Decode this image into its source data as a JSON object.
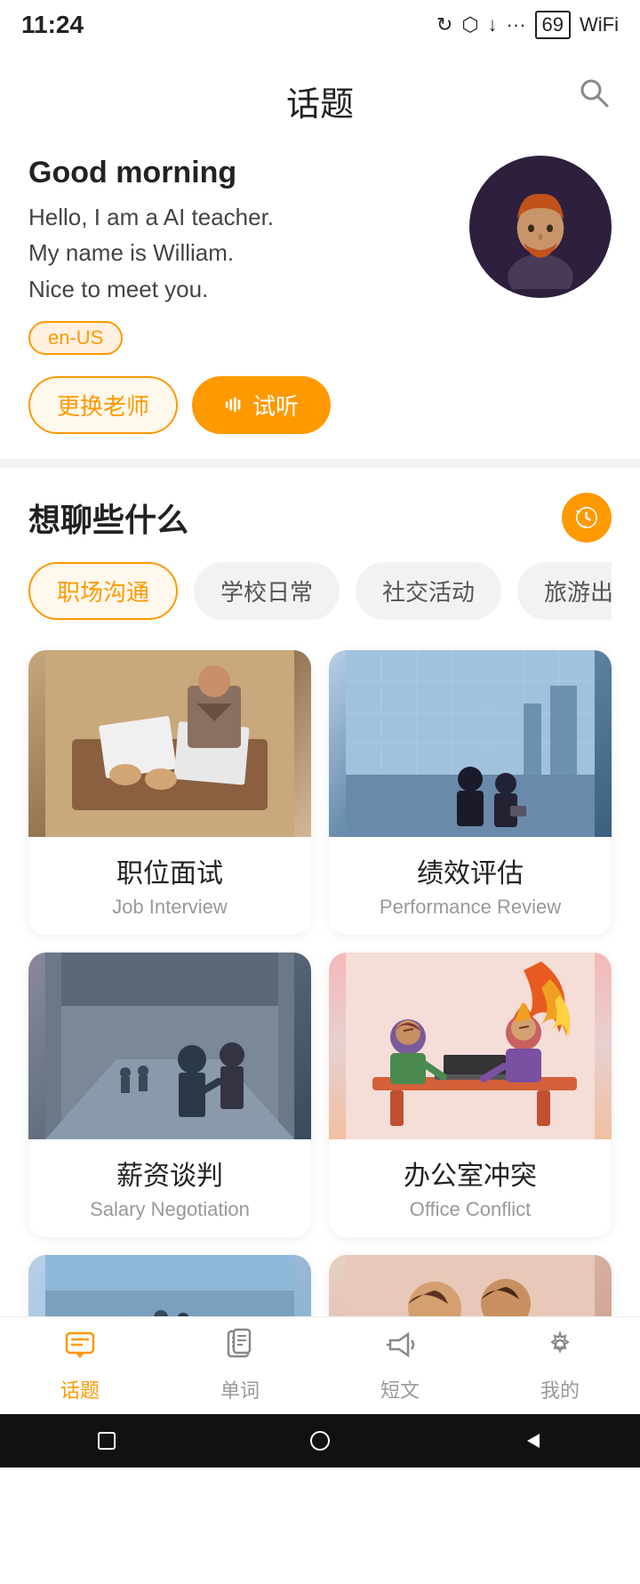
{
  "statusBar": {
    "time": "11:24",
    "icons": [
      "sync",
      "cloud",
      "download",
      "more"
    ]
  },
  "header": {
    "title": "话题",
    "searchLabel": "search"
  },
  "teacher": {
    "greeting": "Good morning",
    "intro": "Hello, I am a AI teacher.\nMy name is William.\nNice to meet you.",
    "lang": "en-US",
    "changeTeacherLabel": "更换老师",
    "auditionLabel": "试听"
  },
  "topicsSection": {
    "title": "想聊些什么",
    "historyLabel": "history"
  },
  "categories": [
    {
      "id": "workplace",
      "zh": "职场沟通",
      "active": true
    },
    {
      "id": "school",
      "zh": "学校日常",
      "active": false
    },
    {
      "id": "social",
      "zh": "社交活动",
      "active": false
    },
    {
      "id": "travel",
      "zh": "旅游出行",
      "active": false
    }
  ],
  "topics": [
    {
      "id": 1,
      "zh": "职位面试",
      "en": "Job Interview",
      "imgStyle": "topic-img-1"
    },
    {
      "id": 2,
      "zh": "绩效评估",
      "en": "Performance Review",
      "imgStyle": "topic-img-2"
    },
    {
      "id": 3,
      "zh": "薪资谈判",
      "en": "Salary Negotiation",
      "imgStyle": "topic-img-3"
    },
    {
      "id": 4,
      "zh": "办公室冲突",
      "en": "Office Conflict",
      "imgStyle": "topic-img-4"
    }
  ],
  "partialTopics": [
    {
      "id": 5,
      "imgStyle": "topic-img-partial-1"
    },
    {
      "id": 6,
      "imgStyle": "topic-img-partial-2"
    }
  ],
  "bottomNav": [
    {
      "id": "topics",
      "label": "话题",
      "icon": "💬",
      "active": true
    },
    {
      "id": "words",
      "label": "单词",
      "icon": "📖",
      "active": false
    },
    {
      "id": "articles",
      "label": "短文",
      "icon": "📢",
      "active": false
    },
    {
      "id": "mine",
      "label": "我的",
      "icon": "⚙️",
      "active": false
    }
  ],
  "androidNav": {
    "square": "□",
    "circle": "○",
    "triangle": "◁"
  }
}
